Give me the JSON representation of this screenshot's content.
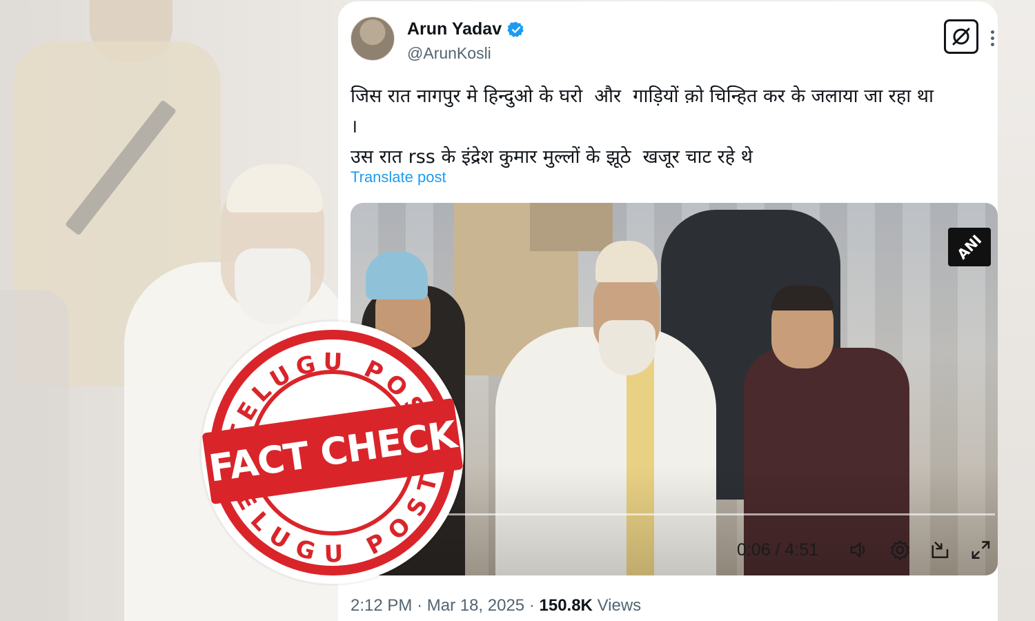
{
  "stamp": {
    "top_text": "TELUGU POST",
    "bottom_text": "TELUGU POST",
    "center_text": "FACT CHECK",
    "color": "#d9252a"
  },
  "tweet": {
    "author_name": "Arun Yadav",
    "verified_icon": "verified-badge-icon",
    "handle": "@ArunKosli",
    "text_lines": [
      "जिस रात नागपुर मे हिन्दुओ के घरो  और  गाड़ियों क़ो चिन्हित कर के जलाया जा रहा था",
      "।",
      "उस रात rss के इंद्रेश कुमार मुल्लों के झूठे  खजूर चाट रहे थे"
    ],
    "translate_label": "Translate post",
    "time": "2:12 PM",
    "separator": "·",
    "date": "Mar 18, 2025",
    "views_count": "150.8K",
    "views_label": "Views"
  },
  "video": {
    "watermark": "ANI",
    "time_display": "0:06 / 4:51",
    "progress_fraction": 0.02
  },
  "colors": {
    "link": "#1d9bf0",
    "verified": "#1d9bf0",
    "text": "#0f1419",
    "muted": "#536471"
  }
}
